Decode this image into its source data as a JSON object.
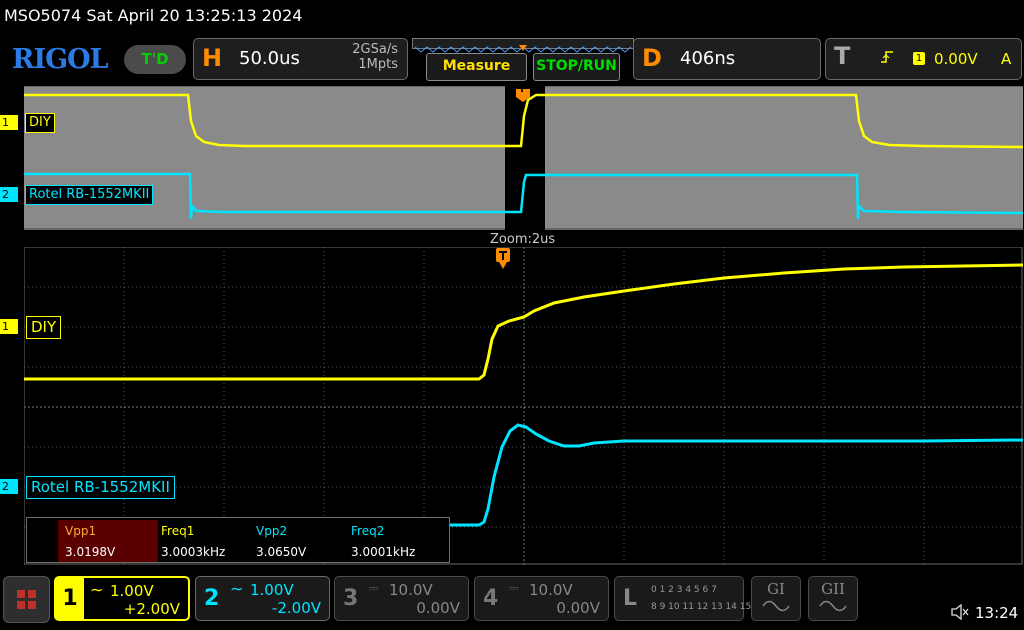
{
  "title": "MSO5074  Sat April 20 13:25:13 2024",
  "logo": "RIGOL",
  "td_label": "T'D",
  "horizontal": {
    "letter": "H",
    "timebase": "50.0us",
    "sample_rate": "2GSa/s",
    "memory": "1Mpts"
  },
  "buttons": {
    "measure": "Measure",
    "stop_run": "STOP/RUN"
  },
  "delay": {
    "letter": "D",
    "value": "406ns"
  },
  "trigger": {
    "letter": "T",
    "source": "1",
    "level": "0.00V",
    "mode": "A",
    "trigger_marker": "T"
  },
  "zoom_label": "Zoom:2us",
  "channels": {
    "ch1": {
      "tag": "1",
      "label": "DIY",
      "color": "#ffff00"
    },
    "ch2": {
      "tag": "2",
      "label": "Rotel RB-1552MKII",
      "color": "#00e5ff"
    }
  },
  "measurements": {
    "headers": [
      "Vpp1",
      "Freq1",
      "Vpp2",
      "Freq2"
    ],
    "values": [
      "3.0198V",
      "3.0003kHz",
      "3.0650V",
      "3.0001kHz"
    ]
  },
  "bottom": {
    "ch1": {
      "num": "1",
      "scale": "1.00V",
      "offset": "+2.00V"
    },
    "ch2": {
      "num": "2",
      "scale": "1.00V",
      "offset": "-2.00V"
    },
    "ch3": {
      "num": "3",
      "scale": "10.0V",
      "offset": "0.00V"
    },
    "ch4": {
      "num": "4",
      "scale": "10.0V",
      "offset": "0.00V"
    },
    "logic": {
      "letter": "L",
      "row1": "0 1 2 3  4 5 6 7",
      "row2": "8 9 10 11 12 13 14 15"
    },
    "gen1": "GI",
    "gen2": "GII",
    "time": "13:24"
  }
}
